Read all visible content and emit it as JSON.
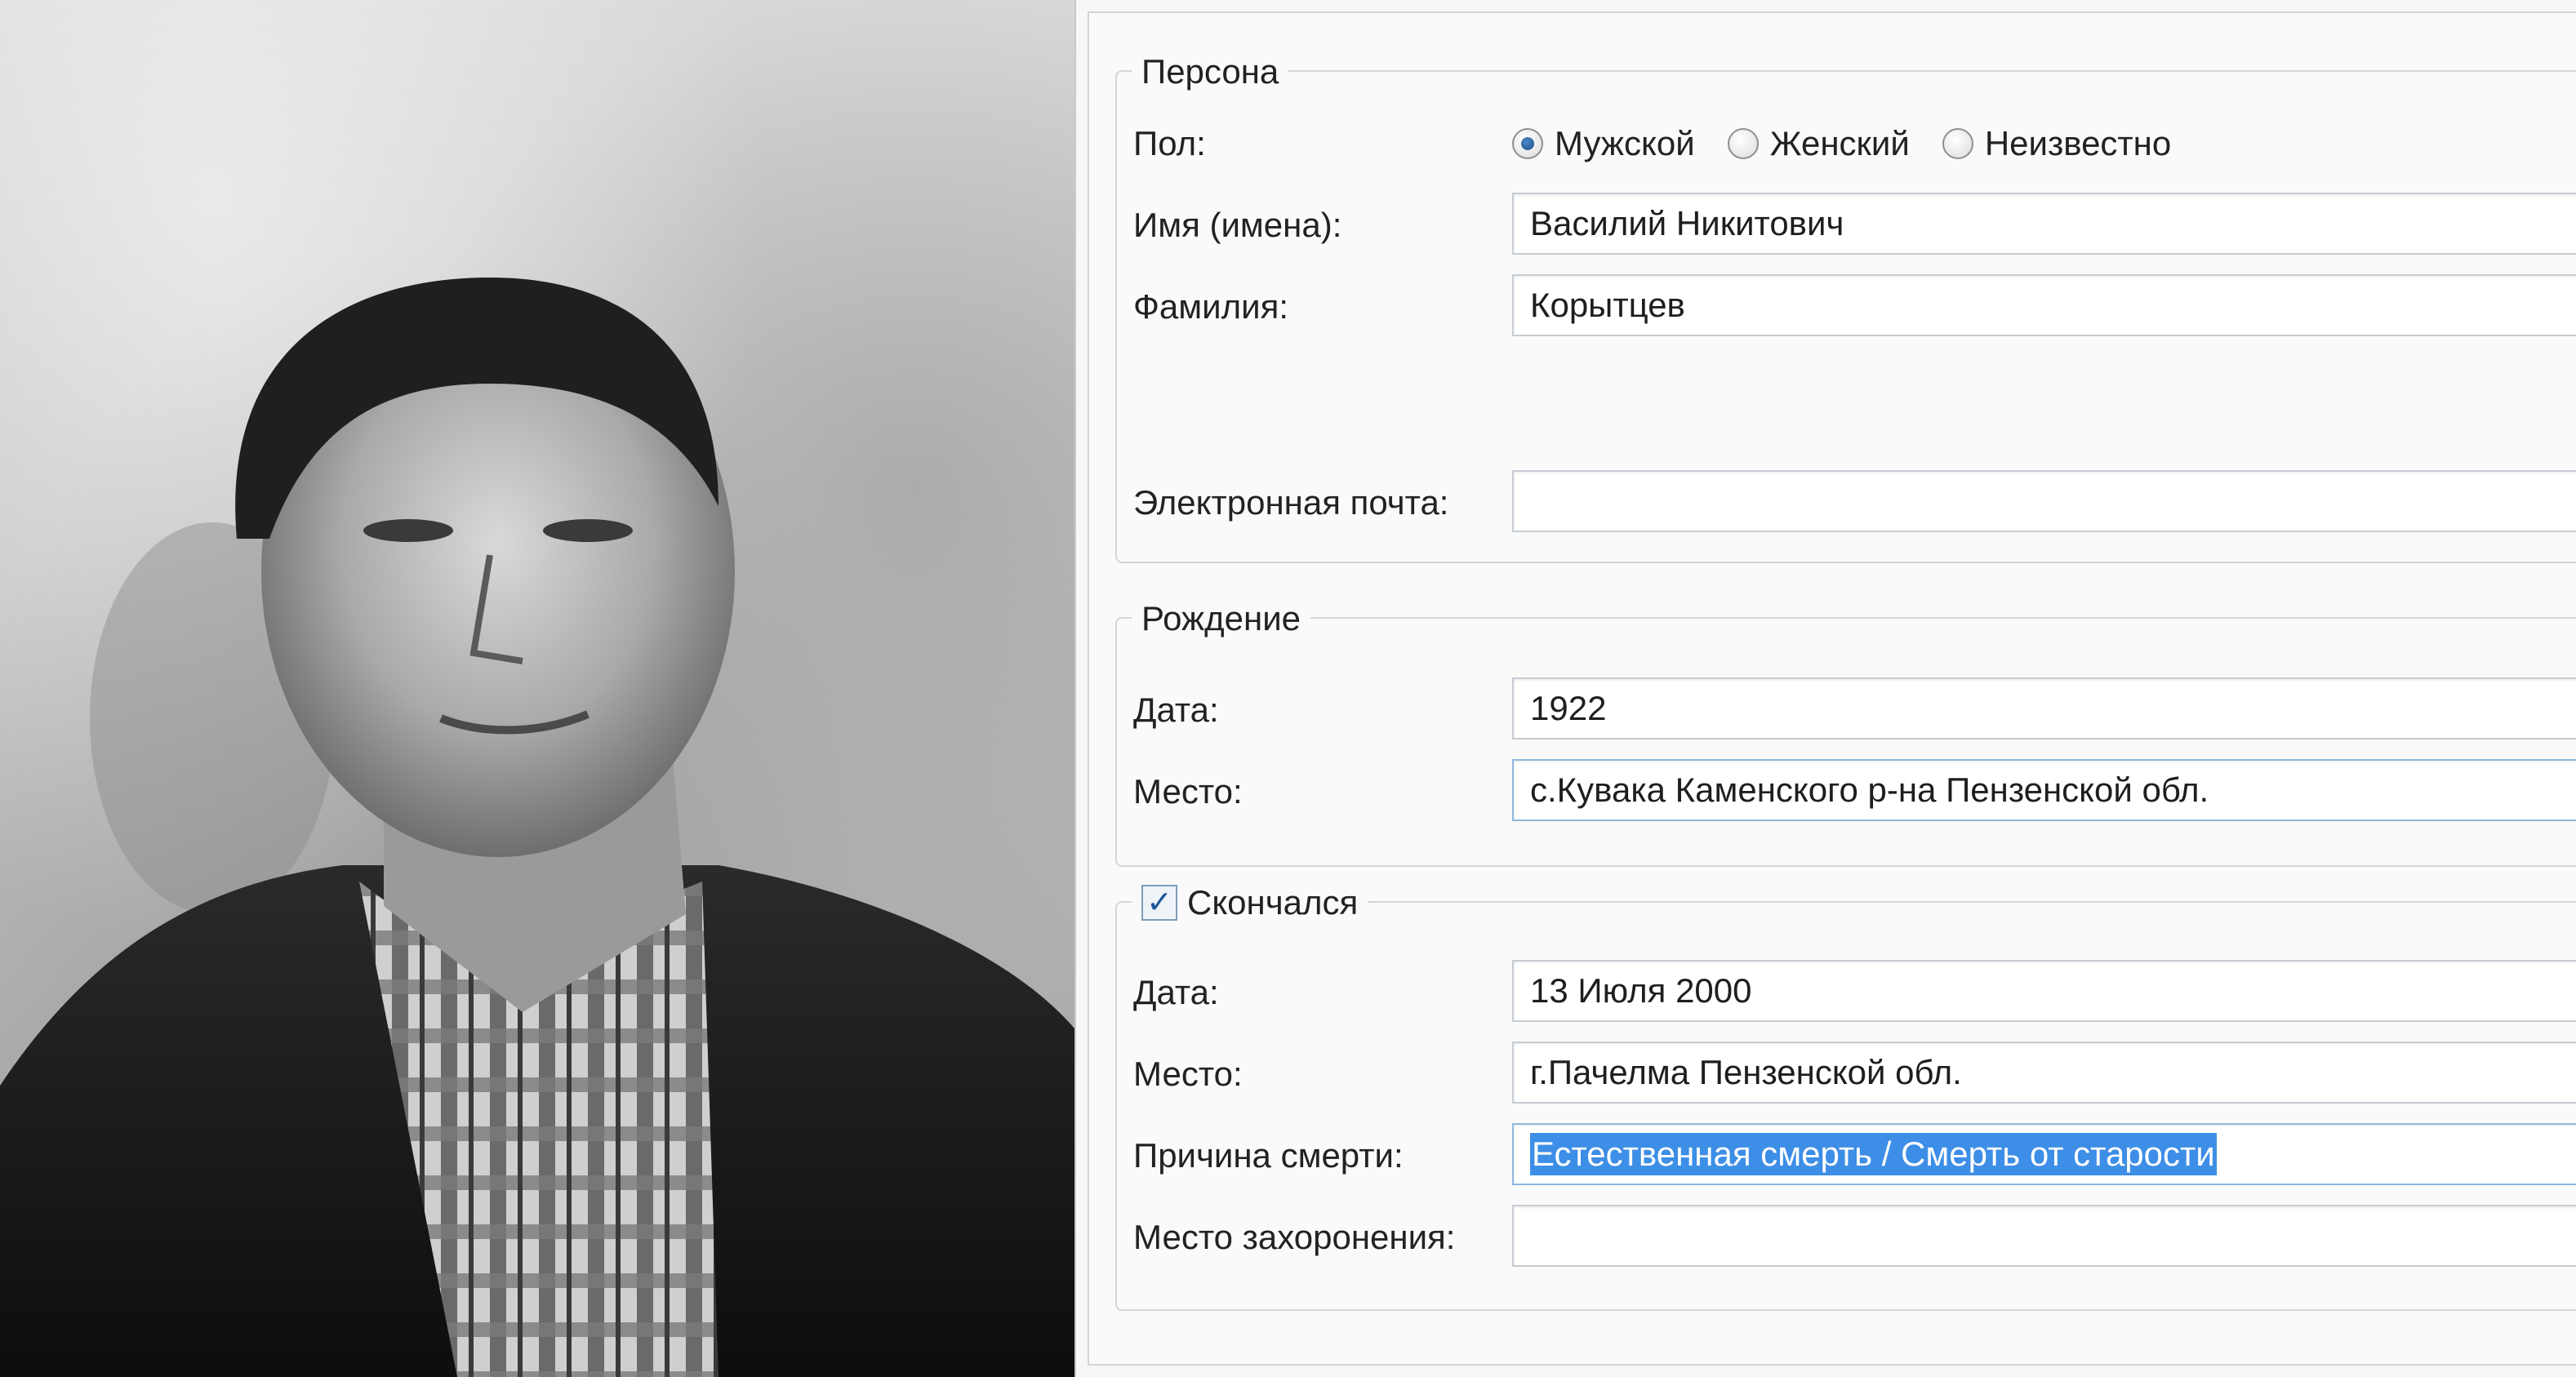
{
  "photo": {
    "alt": ""
  },
  "person": {
    "legend": "Персона",
    "gender_label": "Пол:",
    "gender_options": [
      {
        "label": "Мужской",
        "checked": true
      },
      {
        "label": "Женский",
        "checked": false
      },
      {
        "label": "Неизвестно",
        "checked": false
      }
    ],
    "given_names_label": "Имя (имена):",
    "given_names_value": "Василий Никитович",
    "surname_label": "Фамилия:",
    "surname_value": "Корытцев",
    "email_label": "Электронная почта:",
    "email_value": ""
  },
  "birth": {
    "legend": "Рождение",
    "date_label": "Дата:",
    "date_value": "1922",
    "place_label": "Место:",
    "place_value": "с.Кувака Каменского р-на Пензенской обл."
  },
  "death": {
    "legend": "Скончался",
    "checked": true,
    "date_label": "Дата:",
    "date_value": "13 Июля 2000",
    "place_label": "Место:",
    "place_value": "г.Пачелма Пензенской обл.",
    "cause_label": "Причина смерти:",
    "cause_value": "Естественная смерть / Смерть от старости",
    "burial_label": "Место захоронения:",
    "burial_value": ""
  },
  "colors": {
    "selection": "#3d8ee6",
    "radio_checked": "#1d4f86",
    "checkbox_check": "#21569a"
  }
}
